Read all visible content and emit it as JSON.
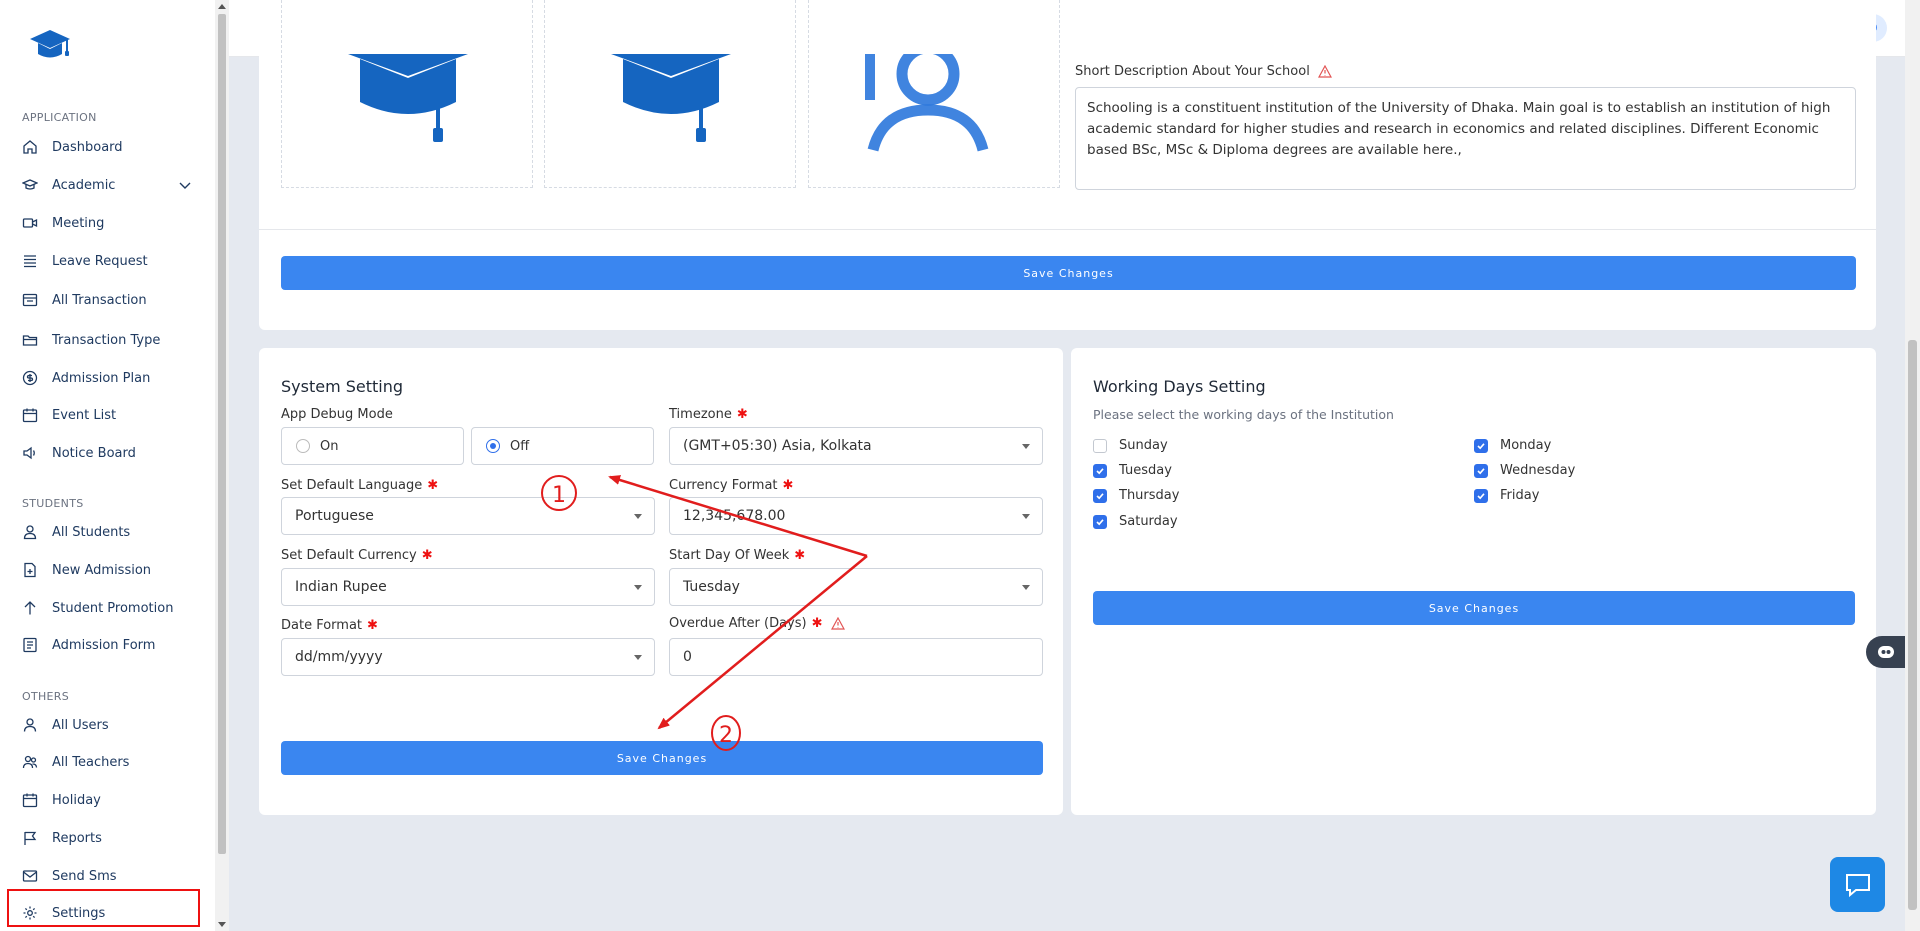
{
  "sidebar": {
    "sections": {
      "application": "APPLICATION",
      "students": "STUDENTS",
      "others": "OTHERS"
    },
    "items": {
      "dashboard": "Dashboard",
      "academic": "Academic",
      "meeting": "Meeting",
      "leave_request": "Leave Request",
      "all_transaction": "All Transaction",
      "transaction_type": "Transaction Type",
      "admission_plan": "Admission Plan",
      "event_list": "Event List",
      "notice_board": "Notice Board",
      "all_students": "All Students",
      "new_admission": "New Admission",
      "student_promotion": "Student Promotion",
      "admission_form": "Admission Form",
      "all_users": "All Users",
      "all_teachers": "All Teachers",
      "holiday": "Holiday",
      "reports": "Reports",
      "send_sms": "Send Sms",
      "settings": "Settings"
    }
  },
  "topbar": {
    "avatar_letter": "D"
  },
  "school_card": {
    "desc_label": "Short Description About Your School",
    "description": "Schooling is a constituent institution of the University of Dhaka.  Main goal  is to establish an institution of high academic standard for higher studies and research in economics and related disciplines. Different Economic based BSc, MSc & Diploma degrees are available here.,",
    "save_label": "Save Changes"
  },
  "system_setting": {
    "title": "System Setting",
    "debug_label": "App Debug Mode",
    "debug_on": "On",
    "debug_off": "Off",
    "debug_value": "Off",
    "timezone_label": "Timezone",
    "timezone_value": "(GMT+05:30) Asia, Kolkata",
    "language_label": "Set Default Language",
    "language_value": "Portuguese",
    "currency_format_label": "Currency Format",
    "currency_format_value": "12,345,678.00",
    "currency_label": "Set Default Currency",
    "currency_value": "Indian Rupee",
    "start_day_label": "Start Day Of Week",
    "start_day_value": "Tuesday",
    "date_format_label": "Date Format",
    "date_format_value": "dd/mm/yyyy",
    "overdue_label": "Overdue After (Days)",
    "overdue_value": "0",
    "save_label": "Save Changes"
  },
  "working_days": {
    "title": "Working Days Setting",
    "subtitle": "Please select the working days of the Institution",
    "days": [
      {
        "name": "Sunday",
        "checked": false
      },
      {
        "name": "Monday",
        "checked": true
      },
      {
        "name": "Tuesday",
        "checked": true
      },
      {
        "name": "Wednesday",
        "checked": true
      },
      {
        "name": "Thursday",
        "checked": true
      },
      {
        "name": "Friday",
        "checked": true
      },
      {
        "name": "Saturday",
        "checked": true
      }
    ],
    "save_label": "Save Changes"
  },
  "annotations": {
    "step1": "1",
    "step2": "2",
    "color": "#e11d1d"
  },
  "colors": {
    "primary": "#3a86f0",
    "sidebar_text": "#1f3a60",
    "logo": "#1565c0"
  }
}
